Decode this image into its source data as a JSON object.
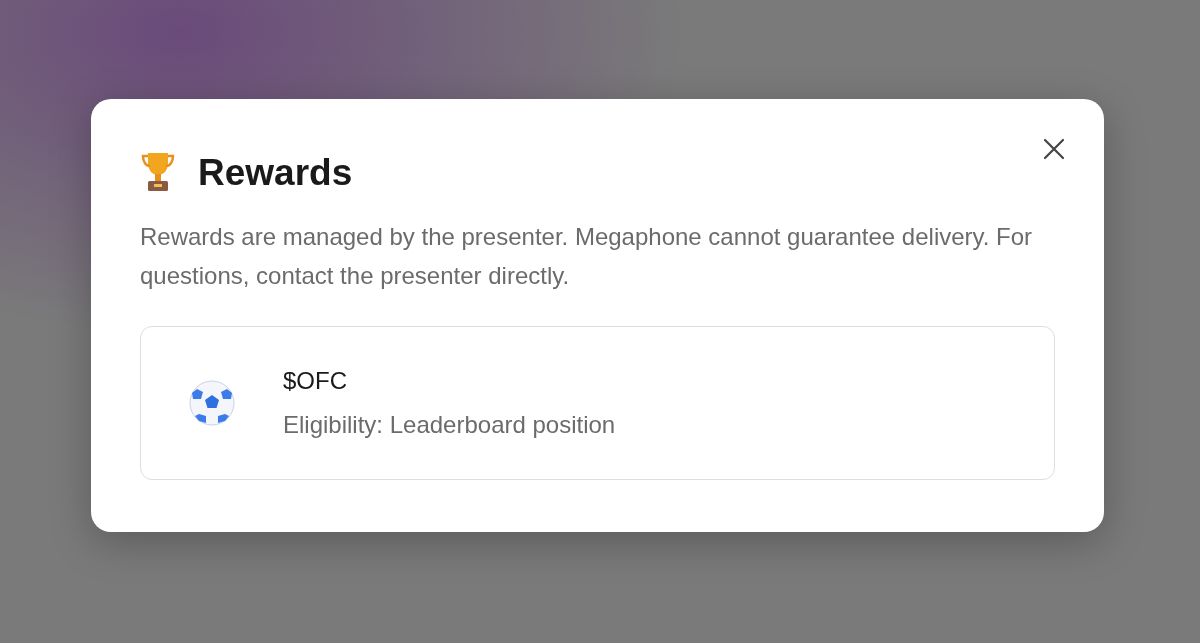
{
  "dialog": {
    "title": "Rewards",
    "description": "Rewards are managed by the presenter. Megaphone cannot guarantee delivery. For questions, contact the presenter directly.",
    "rewards": [
      {
        "name": "$OFC",
        "eligibility": "Eligibility: Leaderboard position"
      }
    ]
  }
}
